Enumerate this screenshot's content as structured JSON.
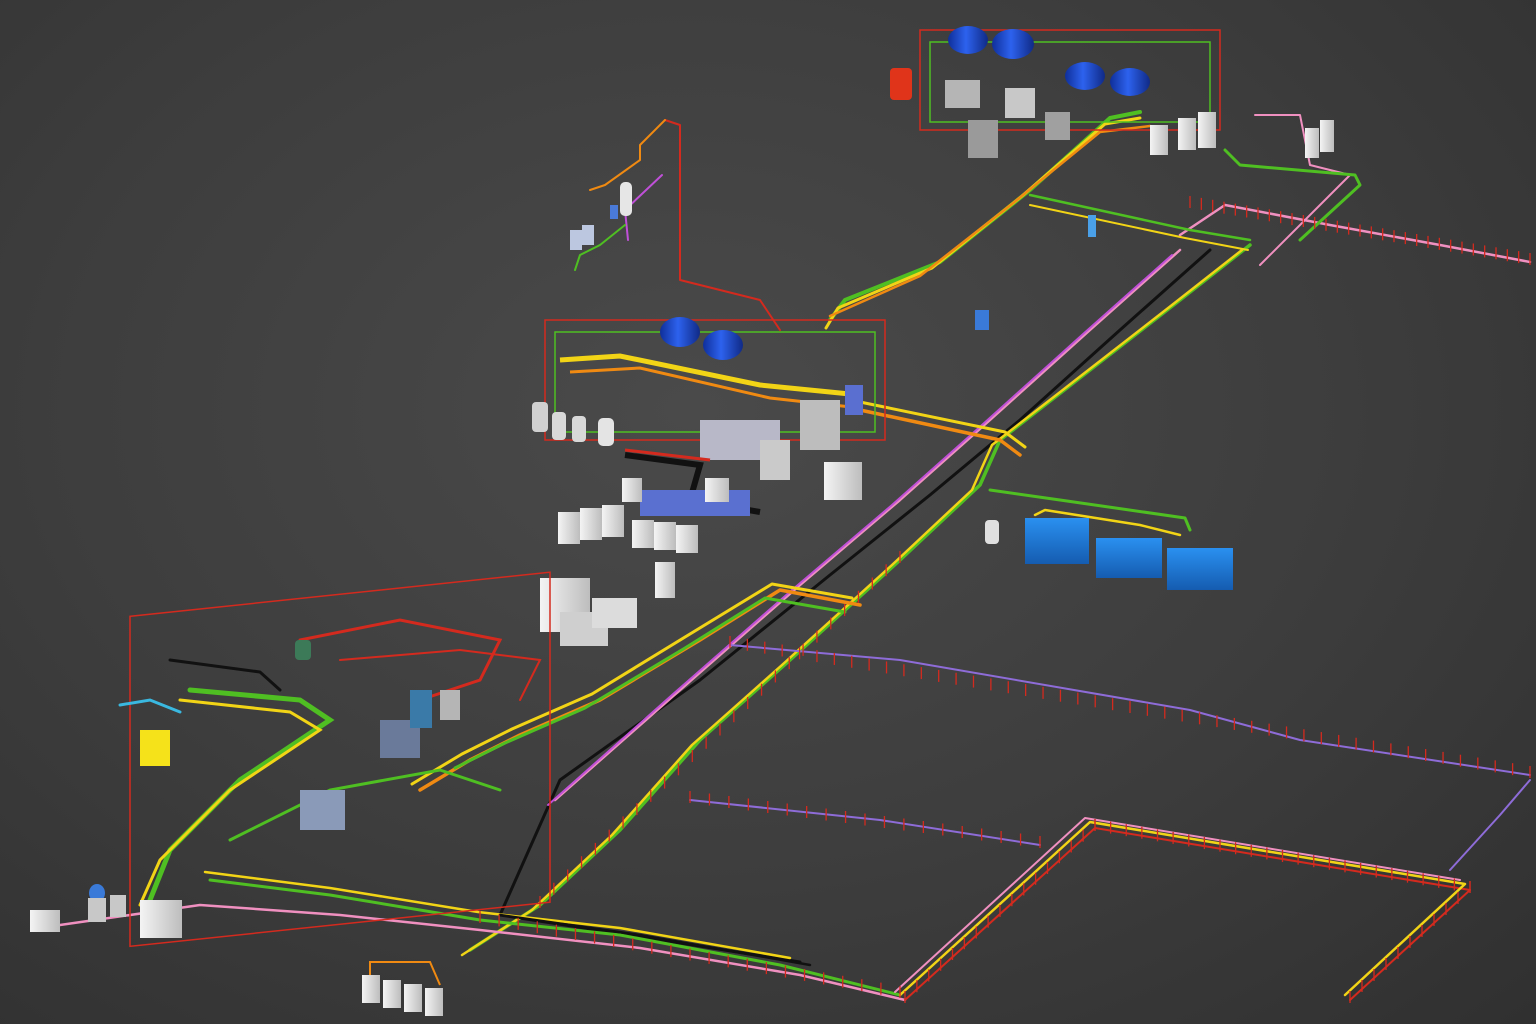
{
  "colors": {
    "background": "#3d3d3d",
    "pipe_red": "#d42a1e",
    "pipe_orange": "#f08a12",
    "pipe_yellow": "#f2d416",
    "pipe_green": "#4fbf22",
    "pipe_pink": "#f090c0",
    "pipe_magenta": "#c050d8",
    "pipe_purple": "#8e6cd8",
    "pipe_black": "#111111",
    "pipe_cyan": "#3ab8e0",
    "tank_blue": "#1f4fd8",
    "cabinet_blue": "#1f7fe0",
    "cabinet_white": "#e6e6e6",
    "cabinet_yellow": "#f5e21a",
    "vessel_red": "#e0341a"
  }
}
